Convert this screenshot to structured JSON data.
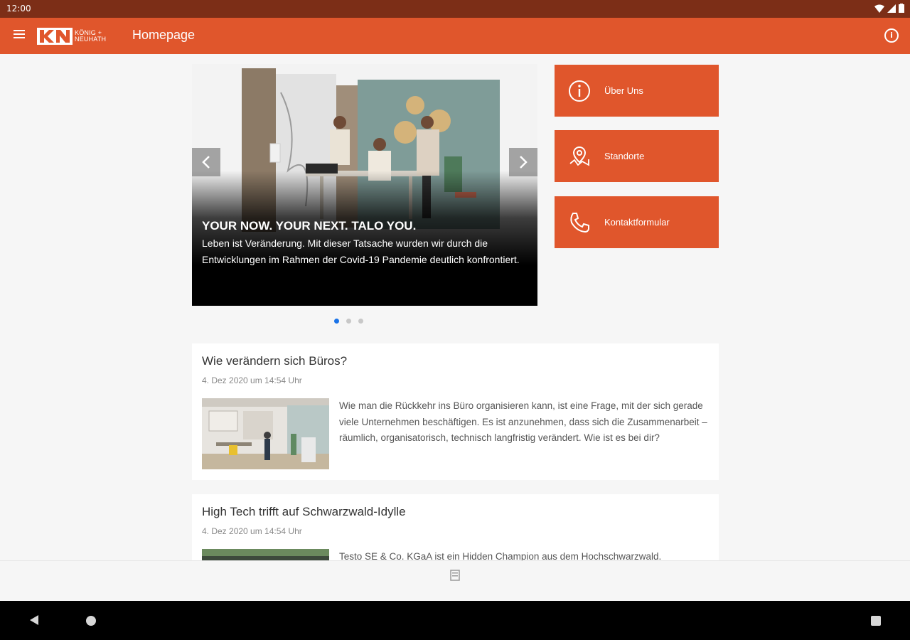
{
  "status_bar": {
    "time": "12:00"
  },
  "app_bar": {
    "title": "Homepage",
    "logo_text_line1": "KÖNIG +",
    "logo_text_line2": "NEUHATH"
  },
  "slider": {
    "title": "YOUR NOW. YOUR NEXT. TALO YOU.",
    "text": "Leben ist Veränderung. Mit dieser Tatsache wurden wir durch die Entwicklungen im Rahmen der Covid-19 Pandemie deutlich konfrontiert.",
    "dot_count": 3,
    "active_dot": 1
  },
  "actions": [
    {
      "label": "Über Uns",
      "icon": "info-icon"
    },
    {
      "label": "Standorte",
      "icon": "map-pin-icon"
    },
    {
      "label": "Kontaktformular",
      "icon": "phone-icon"
    }
  ],
  "articles": [
    {
      "title": "Wie verändern sich Büros?",
      "date": "4. Dez 2020 um 14:54 Uhr",
      "text": "Wie man die Rückkehr ins Büro organisieren kann, ist eine Frage, mit der sich gerade viele Unternehmen beschäftigen. Es ist anzunehmen, dass sich die Zusammenarbeit – räumlich, organisatorisch, technisch langfristig verändert. Wie ist es bei dir?"
    },
    {
      "title": "High Tech trifft auf Schwarzwald-Idylle",
      "date": "4. Dez 2020 um 14:54 Uhr",
      "text": "Testo SE & Co. KGaA ist ein Hidden Champion aus dem Hochschwarzwald."
    }
  ],
  "colors": {
    "status_bar": "#7c2e17",
    "accent": "#e0562c",
    "active_dot": "#1a73e8"
  }
}
